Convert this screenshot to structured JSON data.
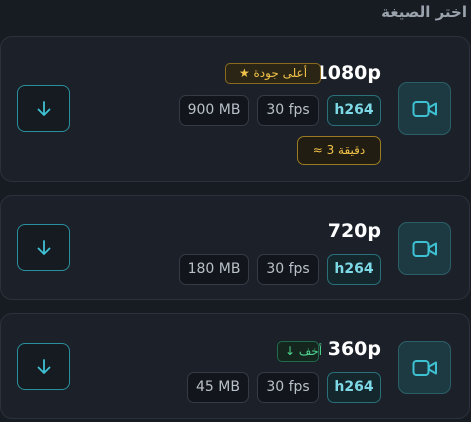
{
  "section_title": "اختر الصيغة",
  "colors": {
    "accent": "#3ec1d3",
    "gold": "#f2c34a",
    "green": "#4ed48f"
  },
  "formats": [
    {
      "resolution": "1080p",
      "badge": "★ أعلى جودة",
      "codec": "h264",
      "fps": "30 fps",
      "size": "900 MB",
      "time_estimate": "≈ 3 دقيقة"
    },
    {
      "resolution": "720p",
      "codec": "h264",
      "fps": "30 fps",
      "size": "180 MB"
    },
    {
      "resolution": "360p",
      "badge": "↓ أخف",
      "codec": "h264",
      "fps": "30 fps",
      "size": "45 MB"
    }
  ],
  "icons": {
    "format": "video-camera-icon",
    "action": "download-arrow-icon"
  }
}
